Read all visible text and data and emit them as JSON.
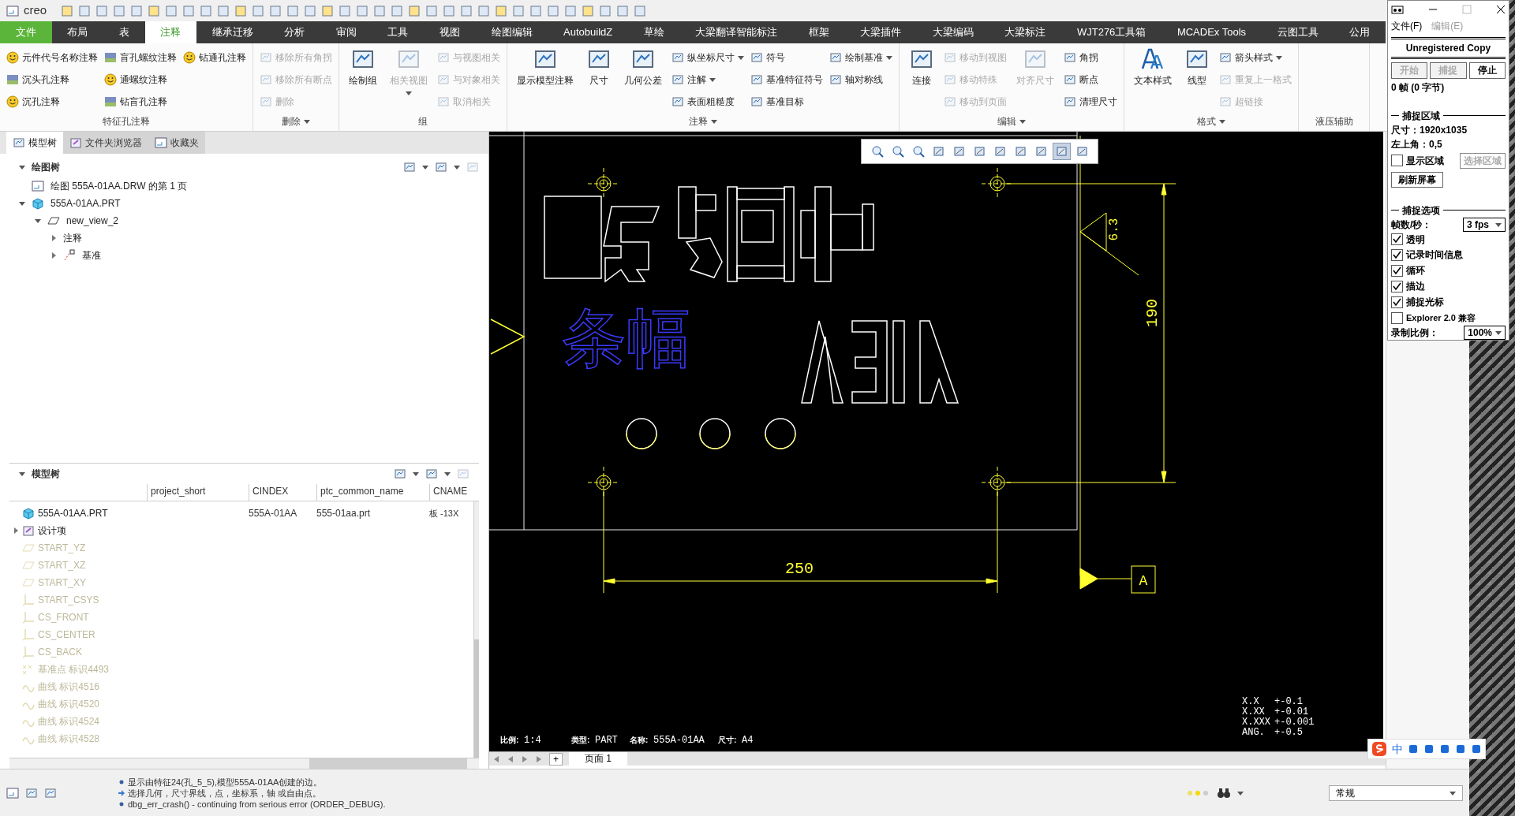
{
  "quick_toolbar": {
    "logo": "creo"
  },
  "tabs": [
    {
      "label": "文件",
      "kind": "file",
      "selected": false
    },
    {
      "label": "布局",
      "kind": "tab",
      "selected": false
    },
    {
      "label": "表",
      "kind": "tab",
      "selected": false
    },
    {
      "label": "注释",
      "kind": "tab",
      "selected": true
    },
    {
      "label": "继承迁移",
      "kind": "tab",
      "selected": false
    },
    {
      "label": "分析",
      "kind": "tab",
      "selected": false
    },
    {
      "label": "审阅",
      "kind": "tab",
      "selected": false
    },
    {
      "label": "工具",
      "kind": "tab",
      "selected": false
    },
    {
      "label": "视图",
      "kind": "tab",
      "selected": false
    },
    {
      "label": "绘图编辑",
      "kind": "tab",
      "selected": false
    },
    {
      "label": "AutobuildZ",
      "kind": "tab",
      "selected": false
    },
    {
      "label": "草绘",
      "kind": "tab",
      "selected": false
    },
    {
      "label": "大梁翻译智能标注",
      "kind": "tab",
      "selected": false
    },
    {
      "label": "框架",
      "kind": "tab",
      "selected": false
    },
    {
      "label": "大梁插件",
      "kind": "tab",
      "selected": false
    },
    {
      "label": "大梁编码",
      "kind": "tab",
      "selected": false
    },
    {
      "label": "大梁标注",
      "kind": "tab",
      "selected": false
    },
    {
      "label": "WJT276工具箱",
      "kind": "tab",
      "selected": false
    },
    {
      "label": "MCADEx Tools",
      "kind": "tab",
      "selected": false
    },
    {
      "label": "云图工具",
      "kind": "tab",
      "selected": false
    },
    {
      "label": "公用",
      "kind": "tab",
      "selected": false
    }
  ],
  "ribbon": [
    {
      "label": "特征孔注释",
      "columns": [
        {
          "kind": "small",
          "items": [
            {
              "label": "元件代号名称注释",
              "kind": "smiley",
              "disabled": false
            },
            {
              "label": "沉头孔注释",
              "kind": "swatch",
              "disabled": false
            },
            {
              "label": "沉孔注释",
              "kind": "smiley",
              "disabled": false
            }
          ]
        },
        {
          "kind": "small",
          "items": [
            {
              "label": "盲孔螺纹注释",
              "kind": "swatch",
              "disabled": false
            },
            {
              "label": "通螺纹注释",
              "kind": "smiley",
              "disabled": false
            },
            {
              "label": "钻盲孔注释",
              "kind": "swatch",
              "disabled": false
            }
          ]
        },
        {
          "kind": "small",
          "items": [
            {
              "label": "钻通孔注释",
              "kind": "smiley",
              "disabled": false
            }
          ]
        }
      ]
    },
    {
      "label": "删除",
      "dropdown": true,
      "columns": [
        {
          "kind": "small",
          "items": [
            {
              "label": "移除所有角拐",
              "kind": "tool",
              "disabled": true
            },
            {
              "label": "移除所有断点",
              "kind": "tool",
              "disabled": true
            },
            {
              "label": "删除",
              "kind": "tool",
              "disabled": true
            }
          ]
        }
      ]
    },
    {
      "label": "组",
      "columns": [
        {
          "kind": "large",
          "items": [
            {
              "label": "绘制组",
              "kind": "tool",
              "disabled": false
            }
          ]
        },
        {
          "kind": "large",
          "items": [
            {
              "label": "相关视图",
              "kind": "tool",
              "disabled": true,
              "dropdown": true
            }
          ]
        },
        {
          "kind": "small",
          "items": [
            {
              "label": "与视图相关",
              "kind": "tool",
              "disabled": true
            },
            {
              "label": "与对象相关",
              "kind": "tool",
              "disabled": true
            },
            {
              "label": "取消相关",
              "kind": "tool",
              "disabled": true
            }
          ]
        }
      ]
    },
    {
      "label": "注释",
      "dropdown": true,
      "columns": [
        {
          "kind": "large",
          "items": [
            {
              "label": "显示模型注释",
              "kind": "tool",
              "disabled": false
            }
          ]
        },
        {
          "kind": "large",
          "items": [
            {
              "label": "尺寸",
              "kind": "tool",
              "disabled": false
            }
          ]
        },
        {
          "kind": "large",
          "items": [
            {
              "label": "几何公差",
              "kind": "tool",
              "disabled": false
            }
          ]
        },
        {
          "kind": "small",
          "items": [
            {
              "label": "纵坐标尺寸",
              "kind": "tool",
              "disabled": false,
              "dropdown": true
            },
            {
              "label": "注解",
              "kind": "tool",
              "disabled": false,
              "dropdown": true
            },
            {
              "label": "表面粗糙度",
              "kind": "tool",
              "disabled": false
            }
          ]
        },
        {
          "kind": "small",
          "items": [
            {
              "label": "符号",
              "kind": "tool",
              "disabled": false
            },
            {
              "label": "基准特征符号",
              "kind": "tool",
              "disabled": false
            },
            {
              "label": "基准目标",
              "kind": "tool",
              "disabled": false
            }
          ]
        },
        {
          "kind": "small",
          "items": [
            {
              "label": "绘制基准",
              "kind": "tool",
              "disabled": false,
              "dropdown": true
            },
            {
              "label": "轴对称线",
              "kind": "tool",
              "disabled": false
            }
          ]
        }
      ]
    },
    {
      "label": "编辑",
      "dropdown": true,
      "columns": [
        {
          "kind": "large",
          "items": [
            {
              "label": "连接",
              "kind": "tool",
              "disabled": false
            }
          ]
        },
        {
          "kind": "small",
          "items": [
            {
              "label": "移动到视图",
              "kind": "tool",
              "disabled": true
            },
            {
              "label": "移动特殊",
              "kind": "tool",
              "disabled": true
            },
            {
              "label": "移动到页面",
              "kind": "tool",
              "disabled": true
            }
          ]
        },
        {
          "kind": "large",
          "items": [
            {
              "label": "对齐尺寸",
              "kind": "tool",
              "disabled": true
            }
          ]
        },
        {
          "kind": "small",
          "items": [
            {
              "label": "角拐",
              "kind": "tool",
              "disabled": false
            },
            {
              "label": "断点",
              "kind": "tool",
              "disabled": false
            },
            {
              "label": "清理尺寸",
              "kind": "tool",
              "disabled": false
            }
          ]
        }
      ]
    },
    {
      "label": "格式",
      "dropdown": true,
      "columns": [
        {
          "kind": "large",
          "items": [
            {
              "label": "文本样式",
              "kind": "text",
              "disabled": false
            }
          ]
        },
        {
          "kind": "large",
          "items": [
            {
              "label": "线型",
              "kind": "tool",
              "disabled": false
            }
          ]
        },
        {
          "kind": "small",
          "items": [
            {
              "label": "箭头样式",
              "kind": "tool",
              "disabled": false,
              "dropdown": true
            },
            {
              "label": "重复上一格式",
              "kind": "tool",
              "disabled": true
            },
            {
              "label": "超链接",
              "kind": "tool",
              "disabled": true
            }
          ]
        }
      ]
    },
    {
      "label": "液压辅助"
    }
  ],
  "left_panel": {
    "tabs": [
      {
        "label": "模型树",
        "selected": true
      },
      {
        "label": "文件夹浏览器",
        "selected": false
      },
      {
        "label": "收藏夹",
        "selected": false
      }
    ],
    "drawing_tree": {
      "title": "绘图树",
      "expanded": true,
      "items": [
        {
          "label": "绘图 555A-01AA.DRW 的第 1 页",
          "kind": "sheet"
        },
        {
          "label": "555A-01AA.PRT",
          "kind": "part",
          "expanded": true,
          "children": [
            {
              "label": "new_view_2",
              "kind": "view",
              "expanded": true,
              "children": [
                {
                  "label": "注释",
                  "kind": "note",
                  "expanded": false
                },
                {
                  "label": "基准",
                  "kind": "datum",
                  "expanded": false
                }
              ]
            }
          ]
        }
      ]
    },
    "model_tree": {
      "title": "模型树",
      "expanded": true,
      "columns": [
        "project_short",
        "CINDEX",
        "ptc_common_name",
        "CNAME"
      ],
      "rows": [
        {
          "label": "555A-01AA.PRT",
          "kind": "part",
          "disabled": false,
          "cindex": "555A-01AA",
          "common_name": "555-01aa.prt",
          "cname": "板 -13X"
        },
        {
          "label": "设计项",
          "kind": "design",
          "disabled": false,
          "expanded": false
        },
        {
          "label": "START_YZ",
          "kind": "plane",
          "disabled": true
        },
        {
          "label": "START_XZ",
          "kind": "plane",
          "disabled": true
        },
        {
          "label": "START_XY",
          "kind": "plane",
          "disabled": true
        },
        {
          "label": "START_CSYS",
          "kind": "csys",
          "disabled": true
        },
        {
          "label": "CS_FRONT",
          "kind": "csys",
          "disabled": true
        },
        {
          "label": "CS_CENTER",
          "kind": "csys",
          "disabled": true
        },
        {
          "label": "CS_BACK",
          "kind": "csys",
          "disabled": true
        },
        {
          "label": "基准点 标识4493",
          "kind": "point",
          "disabled": true
        },
        {
          "label": "曲线 标识4516",
          "kind": "curve",
          "disabled": true
        },
        {
          "label": "曲线 标识4520",
          "kind": "curve",
          "disabled": true
        },
        {
          "label": "曲线 标识4524",
          "kind": "curve",
          "disabled": true
        },
        {
          "label": "曲线 标识4528",
          "kind": "curve",
          "disabled": true
        }
      ]
    }
  },
  "canvas": {
    "view_toolbar": [
      {
        "selected": false
      },
      {
        "selected": false
      },
      {
        "selected": false
      },
      {
        "selected": false
      },
      {
        "selected": false
      },
      {
        "selected": false
      },
      {
        "selected": false
      },
      {
        "selected": false
      },
      {
        "selected": false
      },
      {
        "selected": true
      },
      {
        "selected": false
      }
    ],
    "banner_text": "条幅",
    "dim_horizontal": "250",
    "dim_vertical": "190",
    "roughness": "6.3",
    "datum": "A",
    "title_fields": [
      {
        "label": "比例:",
        "value": "1:4"
      },
      {
        "label": "类型:",
        "value": "PART"
      },
      {
        "label": "名称:",
        "value": "555A-01AA"
      },
      {
        "label": "尺寸:",
        "value": "A4"
      }
    ],
    "tolerances": [
      {
        "format": "X.X",
        "value": "+-0.1"
      },
      {
        "format": "X.XX",
        "value": "+-0.01"
      },
      {
        "format": "X.XXX",
        "value": "+-0.001"
      },
      {
        "format": "ANG.",
        "value": "+-0.5"
      }
    ]
  },
  "page_bar": {
    "add": "+",
    "pages": [
      {
        "label": "页面 1",
        "selected": true
      }
    ]
  },
  "status": {
    "messages": [
      {
        "kind": "info",
        "text": "显示由特征24(孔_5_5),模型555A-01AA创建的边。"
      },
      {
        "kind": "prompt",
        "text": "选择几何，尺寸界线，点，坐标系，轴 或自由点。"
      },
      {
        "kind": "info",
        "text": "dbg_err_crash() - continuing from serious error (ORDER_DEBUG)."
      }
    ],
    "filter": "常规"
  },
  "capture_tool": {
    "menu": [
      {
        "label": "文件(F)",
        "disabled": false
      },
      {
        "label": "编辑(E)",
        "disabled": true
      }
    ],
    "banner": "Unregistered Copy",
    "buttons": [
      {
        "label": "开始",
        "disabled": true
      },
      {
        "label": "捕捉",
        "disabled": true
      },
      {
        "label": "停止",
        "disabled": false
      }
    ],
    "frames": "0 帧 (0 字节)",
    "area_title": "捕捉区域",
    "size": "尺寸：1920x1035",
    "corner": "左上角：0,5",
    "show_area": {
      "label": "显示区域",
      "checked": false
    },
    "select_area": {
      "label": "选择区域",
      "disabled": true
    },
    "refresh": "刷新屏幕",
    "options_title": "捕捉选项",
    "fps_label": "帧数/秒：",
    "fps": "3 fps",
    "options": [
      {
        "label": "透明",
        "checked": true
      },
      {
        "label": "记录时间信息",
        "checked": true
      },
      {
        "label": "循环",
        "checked": true
      },
      {
        "label": "描边",
        "checked": true
      },
      {
        "label": "捕捉光标",
        "checked": true
      },
      {
        "label": "Explorer 2.0 兼容",
        "checked": false
      }
    ],
    "scale_label": "录制比例：",
    "scale": "100%"
  },
  "ime_bar": {
    "mode": "中"
  }
}
